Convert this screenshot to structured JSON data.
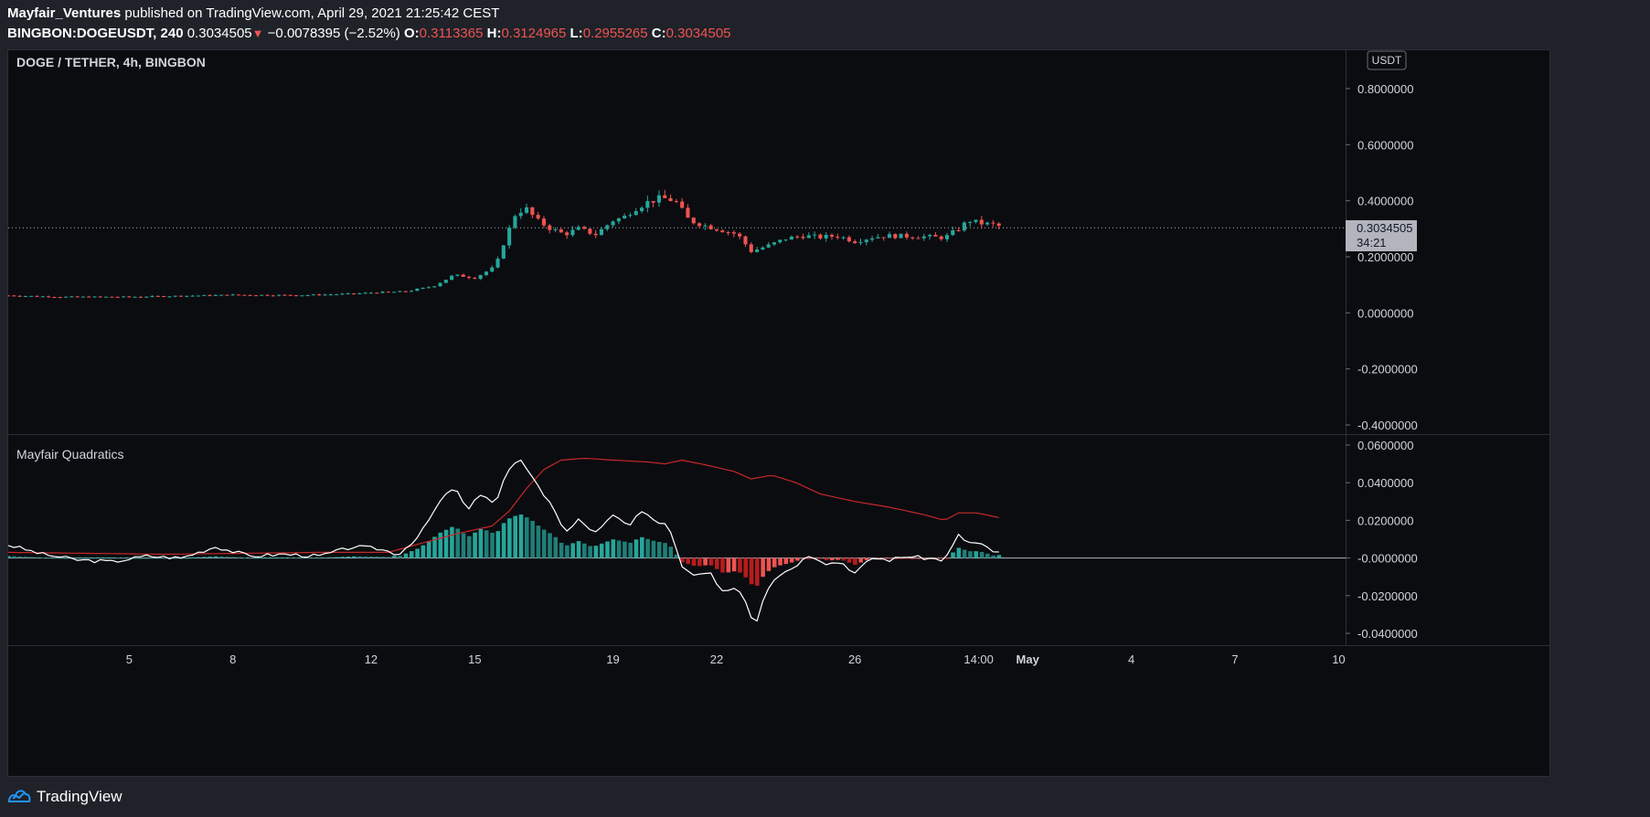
{
  "header": {
    "author": "Mayfair_Ventures",
    "published_text": "published on TradingView.com, April 29, 2021 21:25:42 CEST",
    "symbol": "BINGBON:DOGEUSDT, 240",
    "last_price": "0.3034505",
    "change_arrow": "▼",
    "change": "−0.0078395 (−2.52%)",
    "open_label": "O:",
    "open": "0.3113365",
    "high_label": "H:",
    "high": "0.3124965",
    "low_label": "L:",
    "low": "0.2955265",
    "close_label": "C:",
    "close": "0.3034505"
  },
  "price_pane": {
    "title": "DOGE / TETHER, 4h, BINGBON",
    "currency_button": "USDT",
    "last_price_tag": "0.3034505",
    "countdown_tag": "34:21"
  },
  "indicator_pane": {
    "title": "Mayfair Quadratics"
  },
  "footer": {
    "brand": "TradingView"
  },
  "colors": {
    "up": "#26a69a",
    "down": "#ef5350",
    "hist_up": "#26a69a",
    "hist_up_dark": "#1f7f78",
    "hist_down": "#ef5350",
    "hist_down_dark": "#b71c1c",
    "signal": "#c62828",
    "oscillator": "#ffffff",
    "background": "#0b0c10"
  },
  "chart_data": [
    {
      "type": "candlestick",
      "title": "DOGE / TETHER, 4h, BINGBON",
      "y_ticks": [
        "0.8000000",
        "0.6000000",
        "0.4000000",
        "0.2000000",
        "0.0000000",
        "-0.2000000",
        "-0.4000000"
      ],
      "ylim": [
        -0.4,
        0.8
      ],
      "x_ticks": [
        "5",
        "8",
        "12",
        "15",
        "19",
        "22",
        "26",
        "14:00",
        "May",
        "4",
        "7",
        "10"
      ],
      "x_tick_days": [
        5,
        8,
        12,
        15,
        19,
        22,
        26,
        29.583,
        31,
        34,
        37,
        40
      ],
      "xlim_days": [
        1.5,
        40.2
      ],
      "last_price": 0.3034505,
      "close_anchors": [
        [
          1.5,
          0.062
        ],
        [
          3,
          0.057
        ],
        [
          5,
          0.057
        ],
        [
          8,
          0.064
        ],
        [
          10,
          0.063
        ],
        [
          11.5,
          0.068
        ],
        [
          12,
          0.072
        ],
        [
          13,
          0.076
        ],
        [
          13.8,
          0.095
        ],
        [
          14.4,
          0.135
        ],
        [
          15.0,
          0.125
        ],
        [
          15.6,
          0.165
        ],
        [
          15.9,
          0.27
        ],
        [
          16.2,
          0.36
        ],
        [
          16.5,
          0.37
        ],
        [
          16.8,
          0.33
        ],
        [
          17.2,
          0.3
        ],
        [
          17.6,
          0.28
        ],
        [
          18.0,
          0.3
        ],
        [
          18.5,
          0.28
        ],
        [
          19.0,
          0.33
        ],
        [
          19.3,
          0.34
        ],
        [
          19.6,
          0.37
        ],
        [
          20.0,
          0.395
        ],
        [
          20.4,
          0.41
        ],
        [
          20.8,
          0.4
        ],
        [
          21.2,
          0.33
        ],
        [
          21.7,
          0.31
        ],
        [
          22.0,
          0.3
        ],
        [
          22.6,
          0.28
        ],
        [
          23.0,
          0.22
        ],
        [
          23.5,
          0.24
        ],
        [
          24.0,
          0.265
        ],
        [
          24.5,
          0.275
        ],
        [
          25.0,
          0.27
        ],
        [
          25.5,
          0.275
        ],
        [
          26.0,
          0.255
        ],
        [
          26.5,
          0.27
        ],
        [
          27.0,
          0.275
        ],
        [
          28.0,
          0.272
        ],
        [
          28.6,
          0.268
        ],
        [
          29.0,
          0.3
        ],
        [
          29.3,
          0.33
        ],
        [
          29.6,
          0.32
        ],
        [
          30.0,
          0.315
        ],
        [
          30.3,
          0.305
        ]
      ]
    },
    {
      "type": "line+histogram",
      "title": "Mayfair Quadratics",
      "y_ticks": [
        "0.0600000",
        "0.0400000",
        "0.0200000",
        "-0.0000000",
        "-0.0200000",
        "-0.0400000"
      ],
      "ylim": [
        -0.045,
        0.063
      ],
      "oscillator_anchors": [
        [
          1.5,
          0.007
        ],
        [
          2.5,
          0.002
        ],
        [
          3.5,
          -0.001
        ],
        [
          4.5,
          -0.002
        ],
        [
          5.5,
          0.001
        ],
        [
          6.5,
          0.0
        ],
        [
          7.5,
          0.006
        ],
        [
          8.5,
          0.001
        ],
        [
          9.5,
          0.002
        ],
        [
          10.5,
          0.001
        ],
        [
          11.5,
          0.006
        ],
        [
          12.2,
          0.005
        ],
        [
          12.8,
          0.002
        ],
        [
          13.4,
          0.012
        ],
        [
          14.0,
          0.03
        ],
        [
          14.4,
          0.038
        ],
        [
          14.8,
          0.025
        ],
        [
          15.2,
          0.035
        ],
        [
          15.6,
          0.028
        ],
        [
          15.9,
          0.045
        ],
        [
          16.3,
          0.052
        ],
        [
          16.6,
          0.046
        ],
        [
          16.9,
          0.036
        ],
        [
          17.3,
          0.026
        ],
        [
          17.6,
          0.014
        ],
        [
          18.0,
          0.02
        ],
        [
          18.4,
          0.013
        ],
        [
          19.0,
          0.022
        ],
        [
          19.5,
          0.018
        ],
        [
          19.8,
          0.025
        ],
        [
          20.2,
          0.02
        ],
        [
          20.6,
          0.017
        ],
        [
          21.0,
          -0.005
        ],
        [
          21.4,
          -0.01
        ],
        [
          21.8,
          -0.008
        ],
        [
          22.2,
          -0.018
        ],
        [
          22.6,
          -0.015
        ],
        [
          22.9,
          -0.025
        ],
        [
          23.1,
          -0.037
        ],
        [
          23.4,
          -0.018
        ],
        [
          23.7,
          -0.01
        ],
        [
          24.2,
          -0.005
        ],
        [
          24.7,
          0.002
        ],
        [
          25.2,
          -0.003
        ],
        [
          25.6,
          -0.002
        ],
        [
          26.0,
          -0.008
        ],
        [
          26.5,
          0.0
        ],
        [
          27.0,
          -0.001
        ],
        [
          27.5,
          0.001
        ],
        [
          28.0,
          0.0
        ],
        [
          28.6,
          -0.001
        ],
        [
          29.0,
          0.012
        ],
        [
          29.3,
          0.008
        ],
        [
          29.6,
          0.008
        ],
        [
          30.0,
          0.003
        ],
        [
          30.3,
          0.004
        ]
      ],
      "signal_anchors": [
        [
          1.5,
          0.003
        ],
        [
          6.0,
          0.002
        ],
        [
          10.5,
          0.003
        ],
        [
          12.5,
          0.003
        ],
        [
          13.5,
          0.008
        ],
        [
          14.5,
          0.013
        ],
        [
          15.5,
          0.017
        ],
        [
          16.0,
          0.025
        ],
        [
          16.5,
          0.037
        ],
        [
          17.0,
          0.047
        ],
        [
          17.5,
          0.052
        ],
        [
          18.2,
          0.053
        ],
        [
          19.0,
          0.052
        ],
        [
          20.0,
          0.051
        ],
        [
          20.5,
          0.05
        ],
        [
          21.0,
          0.052
        ],
        [
          21.8,
          0.049
        ],
        [
          22.5,
          0.046
        ],
        [
          23.0,
          0.042
        ],
        [
          23.6,
          0.044
        ],
        [
          24.3,
          0.04
        ],
        [
          25.0,
          0.034
        ],
        [
          26.0,
          0.03
        ],
        [
          27.0,
          0.027
        ],
        [
          28.0,
          0.023
        ],
        [
          28.6,
          0.02
        ],
        [
          29.0,
          0.024
        ],
        [
          29.5,
          0.024
        ],
        [
          30.3,
          0.021
        ]
      ]
    }
  ]
}
